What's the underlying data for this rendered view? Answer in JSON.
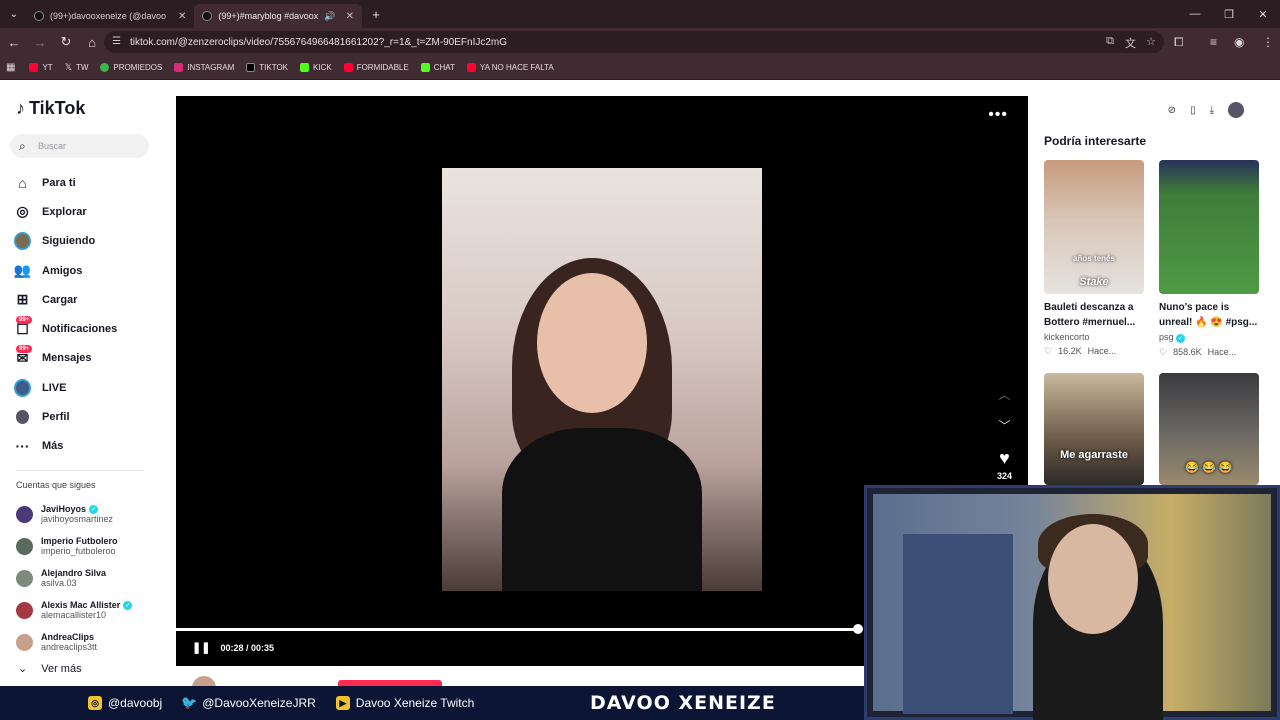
{
  "browser": {
    "tabs": [
      {
        "title": "(99+)davooxeneize (@davoo",
        "active": false
      },
      {
        "title": "(99+)#maryblog #davooxe",
        "active": true
      }
    ],
    "url": "tiktok.com/@zenzeroclips/video/7556764966481661202?_r=1&_t=ZM-90EFnIJc2mG",
    "bookmarks": [
      "YT",
      "TW",
      "PROMIEDOS",
      "INSTAGRAM",
      "TIKTOK",
      "KICK",
      "FORMIDABLE",
      "CHAT",
      "YA NO HACE FALTA"
    ]
  },
  "tiktok": {
    "logo": "TikTok",
    "search_placeholder": "Buscar",
    "nav": [
      {
        "label": "Para ti",
        "icon": "home-icon"
      },
      {
        "label": "Explorar",
        "icon": "compass-icon"
      },
      {
        "label": "Siguiendo",
        "icon": "following-avatar-icon"
      },
      {
        "label": "Amigos",
        "icon": "friends-icon"
      },
      {
        "label": "Cargar",
        "icon": "upload-icon"
      },
      {
        "label": "Notificaciones",
        "icon": "bell-icon",
        "badge": "99+"
      },
      {
        "label": "Mensajes",
        "icon": "message-icon",
        "badge": "99+"
      },
      {
        "label": "LIVE",
        "icon": "live-icon"
      },
      {
        "label": "Perfil",
        "icon": "profile-icon"
      },
      {
        "label": "Más",
        "icon": "more-icon"
      }
    ],
    "following_title": "Cuentas que sigues",
    "following": [
      {
        "name": "JaviHoyos",
        "user": "javihoyosmartinez",
        "verified": true
      },
      {
        "name": "Imperio Futbolero",
        "user": "imperio_futboleroo",
        "verified": false
      },
      {
        "name": "Alejandro Silva",
        "user": "asilva.03",
        "verified": false
      },
      {
        "name": "Alexis Mac Allister",
        "user": "alemacallister10",
        "verified": true
      },
      {
        "name": "AndreaClips",
        "user": "andreaclips3tt",
        "verified": false
      }
    ],
    "ver_mas": "Ver más",
    "video": {
      "likes": "324",
      "time": "00:28 / 00:35",
      "progress": 0.8
    },
    "recommend_title": "Podría interesarte",
    "cards": [
      {
        "title": "Bauleti descanza a Bottero #mernuel...",
        "author": "kickencorto",
        "likes": "16.2K",
        "when": "Hace...",
        "overlay": "años tenés",
        "overlay2": "Stake"
      },
      {
        "title": "Nuno’s pace is unreal! 🔥 😍 #psg...",
        "author": "psg",
        "likes": "858.6K",
        "when": "Hace...",
        "verified": true
      },
      {
        "overlay": "Me agarraste"
      },
      {
        "overlay": "😂 😂 😂"
      }
    ]
  },
  "stream": {
    "instagram": "@davoobj",
    "twitter": "@DavooXeneizeJRR",
    "youtube": "Davoo Xeneize Twitch",
    "brand": "DAVOO XENEIZE"
  }
}
